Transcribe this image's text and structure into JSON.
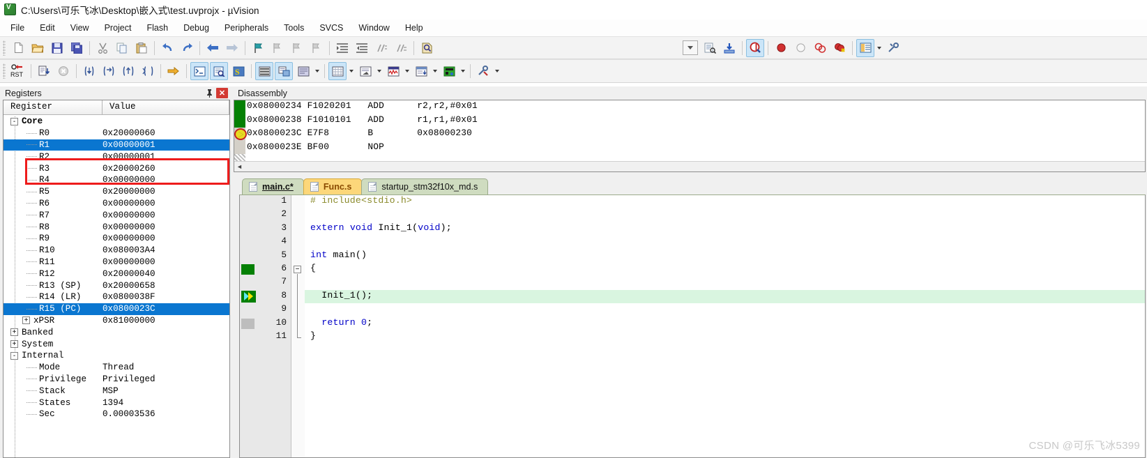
{
  "window": {
    "title": "C:\\Users\\可乐飞冰\\Desktop\\嵌入式\\test.uvprojx - µVision",
    "app_icon": "uvision-logo-icon"
  },
  "menubar": {
    "items": [
      {
        "label": "File"
      },
      {
        "label": "Edit"
      },
      {
        "label": "View"
      },
      {
        "label": "Project"
      },
      {
        "label": "Flash"
      },
      {
        "label": "Debug"
      },
      {
        "label": "Peripherals"
      },
      {
        "label": "Tools"
      },
      {
        "label": "SVCS"
      },
      {
        "label": "Window"
      },
      {
        "label": "Help"
      }
    ]
  },
  "toolbar_main": {
    "buttons": [
      {
        "name": "new-file-icon"
      },
      {
        "name": "open-file-icon"
      },
      {
        "name": "save-icon"
      },
      {
        "name": "save-all-icon"
      },
      {
        "name": "cut-icon"
      },
      {
        "name": "copy-icon"
      },
      {
        "name": "paste-icon"
      },
      {
        "name": "undo-icon"
      },
      {
        "name": "redo-icon"
      },
      {
        "name": "navigate-back-icon"
      },
      {
        "name": "navigate-forward-icon"
      },
      {
        "name": "bookmark-toggle-icon"
      },
      {
        "name": "bookmark-prev-icon"
      },
      {
        "name": "bookmark-next-icon"
      },
      {
        "name": "bookmark-clear-icon"
      },
      {
        "name": "indent-increase-icon"
      },
      {
        "name": "indent-decrease-icon"
      },
      {
        "name": "comment-icon"
      },
      {
        "name": "uncomment-icon"
      },
      {
        "name": "find-in-files-icon"
      }
    ],
    "right_buttons": [
      {
        "name": "combo-dropdown"
      },
      {
        "name": "configure-toolbar-icon"
      },
      {
        "name": "download-to-flash-icon"
      },
      {
        "name": "start-stop-debug-icon",
        "active": true
      },
      {
        "name": "insert-breakpoint-icon"
      },
      {
        "name": "disable-breakpoint-icon"
      },
      {
        "name": "disable-all-breakpoints-icon"
      },
      {
        "name": "kill-all-breakpoints-icon"
      },
      {
        "name": "manage-windows-icon",
        "active": true
      },
      {
        "name": "configure-target-icon"
      }
    ]
  },
  "toolbar_debug": {
    "buttons": [
      {
        "name": "reset-cpu-icon"
      },
      {
        "name": "run-icon"
      },
      {
        "name": "stop-icon"
      },
      {
        "name": "step-into-icon"
      },
      {
        "name": "step-over-icon"
      },
      {
        "name": "step-out-icon"
      },
      {
        "name": "run-to-cursor-icon"
      },
      {
        "name": "show-next-statement-icon"
      },
      {
        "name": "command-window-icon",
        "active": true
      },
      {
        "name": "disassembly-window-icon",
        "active": true
      },
      {
        "name": "symbols-window-icon"
      },
      {
        "name": "registers-window-icon",
        "active": true
      },
      {
        "name": "call-stack-window-icon",
        "active": true
      },
      {
        "name": "watch-windows-icon"
      },
      {
        "name": "memory-windows-icon",
        "active": true
      },
      {
        "name": "serial-windows-icon"
      },
      {
        "name": "analysis-windows-icon"
      },
      {
        "name": "trace-windows-icon"
      },
      {
        "name": "system-viewer-icon"
      },
      {
        "name": "toolbox-icon"
      }
    ]
  },
  "registers_panel": {
    "title": "Registers",
    "pin_icon": "pin-icon",
    "close_icon": "close-icon",
    "columns": [
      "Register",
      "Value"
    ],
    "selection_color": "#0a76d0",
    "highlight_box_color": "#ee1c1c",
    "tree": [
      {
        "name": "Core",
        "value": "",
        "level": 0,
        "expander": "-",
        "bold": true
      },
      {
        "name": "R0",
        "value": "0x20000060",
        "level": 2
      },
      {
        "name": "R1",
        "value": "0x00000001",
        "level": 2,
        "selected": true
      },
      {
        "name": "R2",
        "value": "0x00000001",
        "level": 2
      },
      {
        "name": "R3",
        "value": "0x20000260",
        "level": 2
      },
      {
        "name": "R4",
        "value": "0x00000000",
        "level": 2
      },
      {
        "name": "R5",
        "value": "0x20000000",
        "level": 2
      },
      {
        "name": "R6",
        "value": "0x00000000",
        "level": 2
      },
      {
        "name": "R7",
        "value": "0x00000000",
        "level": 2
      },
      {
        "name": "R8",
        "value": "0x00000000",
        "level": 2
      },
      {
        "name": "R9",
        "value": "0x00000000",
        "level": 2
      },
      {
        "name": "R10",
        "value": "0x080003A4",
        "level": 2
      },
      {
        "name": "R11",
        "value": "0x00000000",
        "level": 2
      },
      {
        "name": "R12",
        "value": "0x20000040",
        "level": 2
      },
      {
        "name": "R13 (SP)",
        "value": "0x20000658",
        "level": 2
      },
      {
        "name": "R14 (LR)",
        "value": "0x0800038F",
        "level": 2
      },
      {
        "name": "R15 (PC)",
        "value": "0x0800023C",
        "level": 2,
        "selected": true
      },
      {
        "name": "xPSR",
        "value": "0x81000000",
        "level": 1,
        "expander": "+"
      },
      {
        "name": "Banked",
        "value": "",
        "level": 0,
        "expander": "+"
      },
      {
        "name": "System",
        "value": "",
        "level": 0,
        "expander": "+"
      },
      {
        "name": "Internal",
        "value": "",
        "level": 0,
        "expander": "-"
      },
      {
        "name": "Mode",
        "value": "Thread",
        "level": 2
      },
      {
        "name": "Privilege",
        "value": "Privileged",
        "level": 2
      },
      {
        "name": "Stack",
        "value": "MSP",
        "level": 2
      },
      {
        "name": "States",
        "value": "1394",
        "level": 2
      },
      {
        "name": "Sec",
        "value": "0.00003536",
        "level": 2
      }
    ]
  },
  "disassembly_panel": {
    "title": "Disassembly",
    "scroll_left_icon": "scroll-left-icon",
    "lines": [
      {
        "address": "0x08000234",
        "opcode": "F1020201",
        "mnemonic": "ADD",
        "operands": "r2,r2,#0x01",
        "marker": "green"
      },
      {
        "address": "0x08000238",
        "opcode": "F1010101",
        "mnemonic": "ADD",
        "operands": "r1,r1,#0x01",
        "marker": "green"
      },
      {
        "address": "0x0800023C",
        "opcode": "E7F8",
        "mnemonic": "B",
        "operands": "0x08000230",
        "marker": "pc"
      },
      {
        "address": "0x0800023E",
        "opcode": "BF00",
        "mnemonic": "NOP",
        "operands": "",
        "marker": "none"
      }
    ]
  },
  "editor": {
    "tabs": [
      {
        "label": "main.c*",
        "state": "active",
        "icon": "file-icon"
      },
      {
        "label": "Func.s",
        "state": "highlight",
        "icon": "file-icon"
      },
      {
        "label": "startup_stm32f10x_md.s",
        "state": "normal",
        "icon": "file-icon"
      }
    ],
    "lines": [
      {
        "number": "1",
        "text": "# include<stdio.h>",
        "style": "preprocessor",
        "marker": "none"
      },
      {
        "number": "2",
        "text": "",
        "style": "plain",
        "marker": "none"
      },
      {
        "number": "3",
        "text": "extern void Init_1(void);",
        "style": "decl",
        "marker": "none"
      },
      {
        "number": "4",
        "text": "",
        "style": "plain",
        "marker": "none"
      },
      {
        "number": "5",
        "text": "int main()",
        "style": "func",
        "marker": "none"
      },
      {
        "number": "6",
        "text": "{",
        "style": "plain",
        "marker": "green",
        "fold": "open"
      },
      {
        "number": "7",
        "text": "",
        "style": "plain",
        "marker": "none"
      },
      {
        "number": "8",
        "text": "  Init_1();",
        "style": "plain",
        "marker": "pc",
        "current": true
      },
      {
        "number": "9",
        "text": "",
        "style": "plain",
        "marker": "none"
      },
      {
        "number": "10",
        "text": "  return 0;",
        "style": "ret",
        "marker": "gray"
      },
      {
        "number": "11",
        "text": "}",
        "style": "plain",
        "marker": "none",
        "fold": "end"
      }
    ]
  },
  "watermark": {
    "text": "CSDN @可乐飞冰5399"
  }
}
